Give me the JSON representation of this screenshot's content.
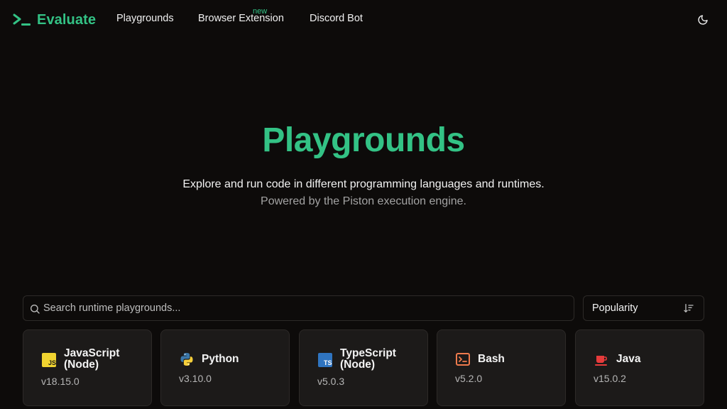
{
  "header": {
    "brand": "Evaluate",
    "nav": [
      "Playgrounds",
      "Browser Extension",
      "Discord Bot"
    ],
    "new_badge": "new",
    "theme_icon": "moon-icon"
  },
  "hero": {
    "title": "Playgrounds",
    "subtitle": "Explore and run code in different programming languages and runtimes.",
    "subtitle2": "Powered by the Piston execution engine."
  },
  "search": {
    "placeholder": "Search runtime playgrounds...",
    "value": ""
  },
  "sort": {
    "label": "Popularity",
    "icon": "sort-descending-icon"
  },
  "cards": [
    {
      "title_line1": "JavaScript",
      "title_line2": "(Node)",
      "version": "v18.15.0",
      "icon": "javascript-icon"
    },
    {
      "title_line1": "Python",
      "title_line2": "",
      "version": "v3.10.0",
      "icon": "python-icon"
    },
    {
      "title_line1": "TypeScript",
      "title_line2": "(Node)",
      "version": "v5.0.3",
      "icon": "typescript-icon"
    },
    {
      "title_line1": "Bash",
      "title_line2": "",
      "version": "v5.2.0",
      "icon": "bash-icon"
    },
    {
      "title_line1": "Java",
      "title_line2": "",
      "version": "v15.0.2",
      "icon": "java-icon"
    }
  ],
  "colors": {
    "accent": "#33c285",
    "background": "#0d0b0a",
    "card": "#1c1a19",
    "border": "#2d2a28"
  }
}
